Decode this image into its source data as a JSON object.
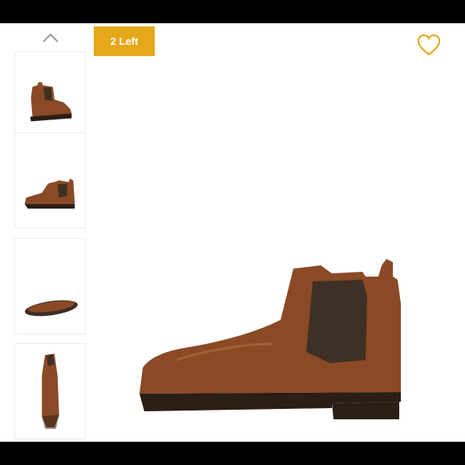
{
  "gallery": {
    "stock_badge": "2 Left",
    "scroll_up_icon": "chevron-up-icon",
    "favorite_icon": "heart-outline-icon",
    "thumbnails": [
      {
        "view": "side-angle"
      },
      {
        "view": "side-profile"
      },
      {
        "view": "sole"
      },
      {
        "view": "front"
      }
    ]
  },
  "colors": {
    "badge": "#e5a81a",
    "heart": "#e5a81a",
    "leather": "#8a4a25",
    "elastic": "#3e3025",
    "sole": "#2a1e16"
  }
}
